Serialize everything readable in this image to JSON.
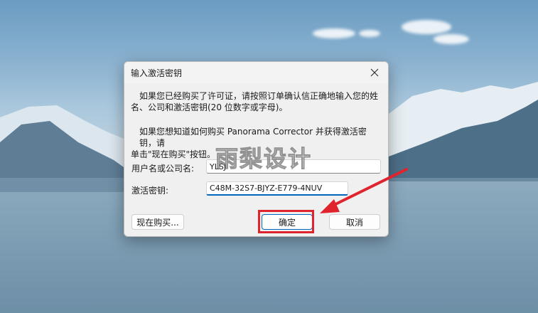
{
  "dialog": {
    "title": "输入激活密钥",
    "paragraph1_line1": "如果您已经购买了许可证，请按照订单确认信正确地输入您的姓",
    "paragraph1_line2": "名、公司和激活密钥(20 位数字或字母)。",
    "paragraph2_line1": "如果您想知道如何购买 Panorama Corrector 并获得激活密钥，请",
    "paragraph2_line2": "单击\"现在购买\"按钮。",
    "username_label": "用户名或公司名:",
    "username_value": "YLSJ",
    "key_label": "激活密钥:",
    "key_value": "C48M-32S7-BJYZ-E779-4NUV",
    "buy_now_label": "现在购买...",
    "ok_label": "确定",
    "cancel_label": "取消"
  },
  "watermark": "雨梨设计",
  "colors": {
    "accent": "#0067c0",
    "annotation_red": "#e0242d"
  },
  "icons": {
    "close": "close-icon"
  }
}
